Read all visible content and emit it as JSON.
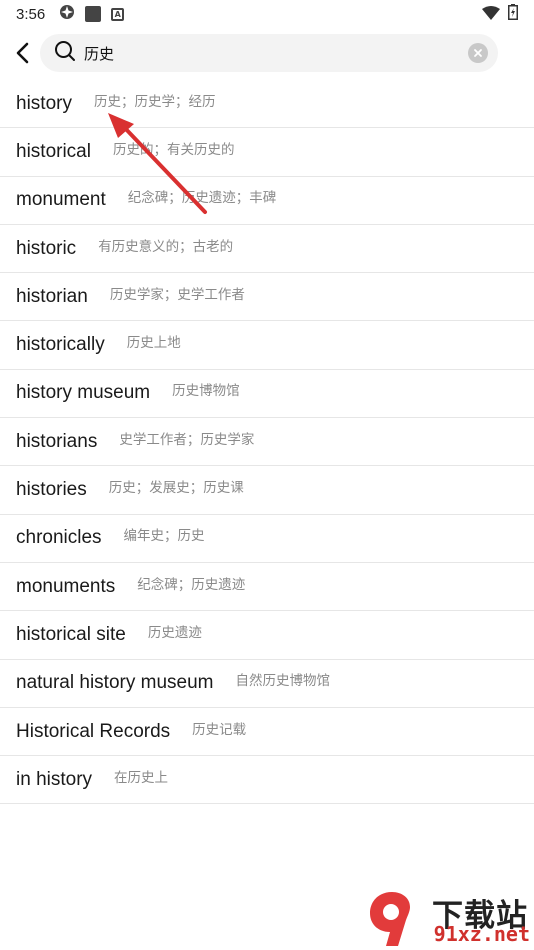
{
  "status_bar": {
    "time": "3:56"
  },
  "search": {
    "query": "历史"
  },
  "results": [
    {
      "word": "history",
      "meaning": "历史；历史学；经历"
    },
    {
      "word": "historical",
      "meaning": "历史的；有关历史的"
    },
    {
      "word": "monument",
      "meaning": "纪念碑；历史遗迹；丰碑"
    },
    {
      "word": "historic",
      "meaning": "有历史意义的；古老的"
    },
    {
      "word": "historian",
      "meaning": "历史学家；史学工作者"
    },
    {
      "word": "historically",
      "meaning": "历史上地"
    },
    {
      "word": "history museum",
      "meaning": "历史博物馆"
    },
    {
      "word": "historians",
      "meaning": "史学工作者；历史学家"
    },
    {
      "word": "histories",
      "meaning": "历史；发展史；历史课"
    },
    {
      "word": "chronicles",
      "meaning": "编年史；历史"
    },
    {
      "word": "monuments",
      "meaning": "纪念碑；历史遗迹"
    },
    {
      "word": "historical site",
      "meaning": "历史遗迹"
    },
    {
      "word": "natural history museum",
      "meaning": "自然历史博物馆"
    },
    {
      "word": "Historical Records",
      "meaning": "历史记载"
    },
    {
      "word": "in history",
      "meaning": "在历史上"
    }
  ],
  "watermark": {
    "brand": "下载站",
    "url": "91xz.net"
  },
  "colors": {
    "annotation_arrow": "#d93030",
    "divider": "#e6e6e6",
    "meaning_text": "#8a8a8a"
  }
}
